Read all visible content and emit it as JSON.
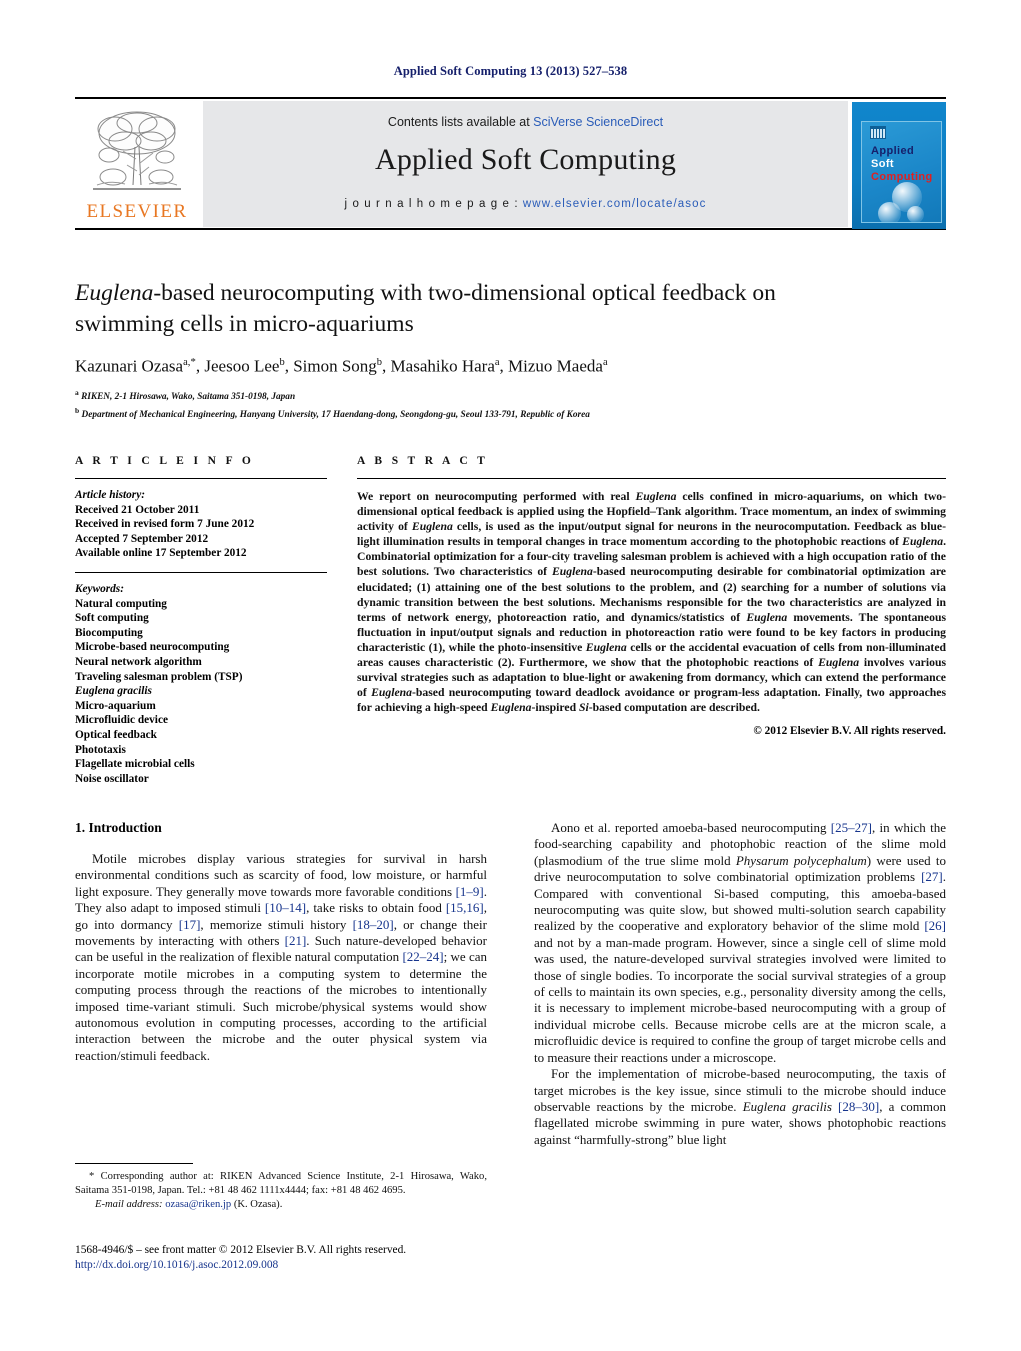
{
  "running_head": "Applied Soft Computing 13 (2013) 527–538",
  "masthead": {
    "publisher_name": "ELSEVIER",
    "contents_prefix": "Contents lists available at ",
    "contents_link": "SciVerse ScienceDirect",
    "journal_title": "Applied Soft Computing",
    "homepage_label": "j o u r n a l   h o m e p a g e :   ",
    "homepage_url": "www.elsevier.com/locate/asoc",
    "cover": {
      "line1": "Applied",
      "line2": "Soft",
      "line3": "Computing"
    }
  },
  "article": {
    "title_html": "<em>Euglena</em>-based neurocomputing with two-dimensional optical feedback on swimming cells in micro-aquariums",
    "authors_html": "Kazunari Ozasa<sup>a,<span style=\"font-size:11px\">*</span></sup>, Jeesoo Lee<sup>b</sup>, Simon Song<sup>b</sup>, Masahiko Hara<sup>a</sup>, Mizuo Maeda<sup>a</sup>",
    "affiliation_a": "RIKEN, 2-1 Hirosawa, Wako, Saitama 351-0198, Japan",
    "affiliation_b": "Department of Mechanical Engineering, Hanyang University, 17 Haendang-dong, Seongdong-gu, Seoul 133-791, Republic of Korea"
  },
  "article_info": {
    "heading": "A R T I C L E   I N F O",
    "history_label": "Article history:",
    "history": [
      "Received 21 October 2011",
      "Received in revised form 7 June 2012",
      "Accepted 7 September 2012",
      "Available online 17 September 2012"
    ],
    "keywords_label": "Keywords:",
    "keywords": [
      "Natural computing",
      "Soft computing",
      "Biocomputing",
      "Microbe-based neurocomputing",
      "Neural network algorithm",
      "Traveling salesman problem (TSP)",
      "Euglena gracilis",
      "Micro-aquarium",
      "Microfluidic device",
      "Optical feedback",
      "Phototaxis",
      "Flagellate microbial cells",
      "Noise oscillator"
    ],
    "keywords_italic_index": 6
  },
  "abstract": {
    "heading": "A B S T R A C T",
    "body_html": "We report on neurocomputing performed with real <em>Euglena</em> cells confined in micro-aquariums, on which two-dimensional optical feedback is applied using the Hopfield–Tank algorithm. Trace momentum, an index of swimming activity of <em>Euglena</em> cells, is used as the input/output signal for neurons in the neurocomputation. Feedback as blue-light illumination results in temporal changes in trace momentum according to the photophobic reactions of <em>Euglena</em>. Combinatorial optimization for a four-city traveling salesman problem is achieved with a high occupation ratio of the best solutions. Two characteristics of <em>Euglena</em>-based neurocomputing desirable for combinatorial optimization are elucidated; (1) attaining one of the best solutions to the problem, and (2) searching for a number of solutions via dynamic transition between the best solutions. Mechanisms responsible for the two characteristics are analyzed in terms of network energy, photoreaction ratio, and dynamics/statistics of <em>Euglena</em> movements. The spontaneous fluctuation in input/output signals and reduction in photoreaction ratio were found to be key factors in producing characteristic (1), while the photo-insensitive <em>Euglena</em> cells or the accidental evacuation of cells from non-illuminated areas causes characteristic (2). Furthermore, we show that the photophobic reactions of <em>Euglena</em> involves various survival strategies such as adaptation to blue-light or awakening from dormancy, which can extend the performance of <em>Euglena</em>-based neurocomputing toward deadlock avoidance or program-less adaptation. Finally, two approaches for achieving a high-speed <em>Euglena</em>-inspired <em>Si</em>-based computation are described.",
    "copyright": "© 2012 Elsevier B.V. All rights reserved."
  },
  "introduction": {
    "heading": "1.  Introduction",
    "left_paragraph_html": "Motile microbes display various strategies for survival in harsh environmental conditions such as scarcity of food, low moisture, or harmful light exposure. They generally move towards more favorable conditions <span class=\"ref\">[1–9]</span>. They also adapt to imposed stimuli <span class=\"ref\">[10–14]</span>, take risks to obtain food <span class=\"ref\">[15,16]</span>, go into dormancy <span class=\"ref\">[17]</span>, memorize stimuli history <span class=\"ref\">[18–20]</span>, or change their movements by interacting with others <span class=\"ref\">[21]</span>. Such nature-developed behavior can be useful in the realization of flexible natural computation <span class=\"ref\">[22–24]</span>; we can incorporate motile microbes in a computing system to determine the computing process through the reactions of the microbes to intentionally imposed time-variant stimuli. Such microbe/physical systems would show autonomous evolution in computing processes, according to the artificial interaction between the microbe and the outer physical system via reaction/stimuli feedback.",
    "right_paragraph_1_html": "Aono et al. reported amoeba-based neurocomputing <span class=\"ref\">[25–27]</span>, in which the food-searching capability and photophobic reaction of the slime mold (plasmodium of the true slime mold <em>Physarum polycephalum</em>) were used to drive neurocomputation to solve combinatorial optimization problems <span class=\"ref\">[27]</span>. Compared with conventional Si-based computing, this amoeba-based neurocomputing was quite slow, but showed multi-solution search capability realized by the cooperative and exploratory behavior of the slime mold <span class=\"ref\">[26]</span> and not by a man-made program. However, since a single cell of slime mold was used, the nature-developed survival strategies involved were limited to those of single bodies. To incorporate the social survival strategies of a group of cells to maintain its own species, e.g., personality diversity among the cells, it is necessary to implement microbe-based neurocomputing with a group of individual microbe cells. Because microbe cells are at the micron scale, a microfluidic device is required to confine the group of target microbe cells and to measure their reactions under a microscope.",
    "right_paragraph_2_html": "For the implementation of microbe-based neurocomputing, the taxis of target microbes is the key issue, since stimuli to the microbe should induce observable reactions by the microbe. <em>Euglena gracilis</em> <span class=\"ref\">[28–30]</span>, a common flagellated microbe swimming in pure water, shows photophobic reactions against “harmfully-strong” blue light"
  },
  "footnote": {
    "text_html": "<span style=\"padding-left:14px\">*</span>  Corresponding author at: RIKEN Advanced Science Institute, 2-1 Hirosawa, Wako, Saitama 351-0198, Japan. Tel.: +81 48 462 1111x4444; fax: +81 48 462 4695.<br><span style=\"padding-left:20px\"></span><span class=\"ital\">E-mail address:</span> <span class=\"mail\">ozasa@riken.jp</span> (K. Ozasa)."
  },
  "imprint": {
    "line1": "1568-4946/$ – see front matter © 2012 Elsevier B.V. All rights reserved.",
    "doi": "http://dx.doi.org/10.1016/j.asoc.2012.09.008"
  },
  "colors": {
    "runhead": "#16206b",
    "link": "#2a5cb8",
    "reference": "#16348c",
    "elsevier_orange": "#e87722",
    "band_gray": "#e6e7e9",
    "cover_blue": "#1186cc"
  }
}
